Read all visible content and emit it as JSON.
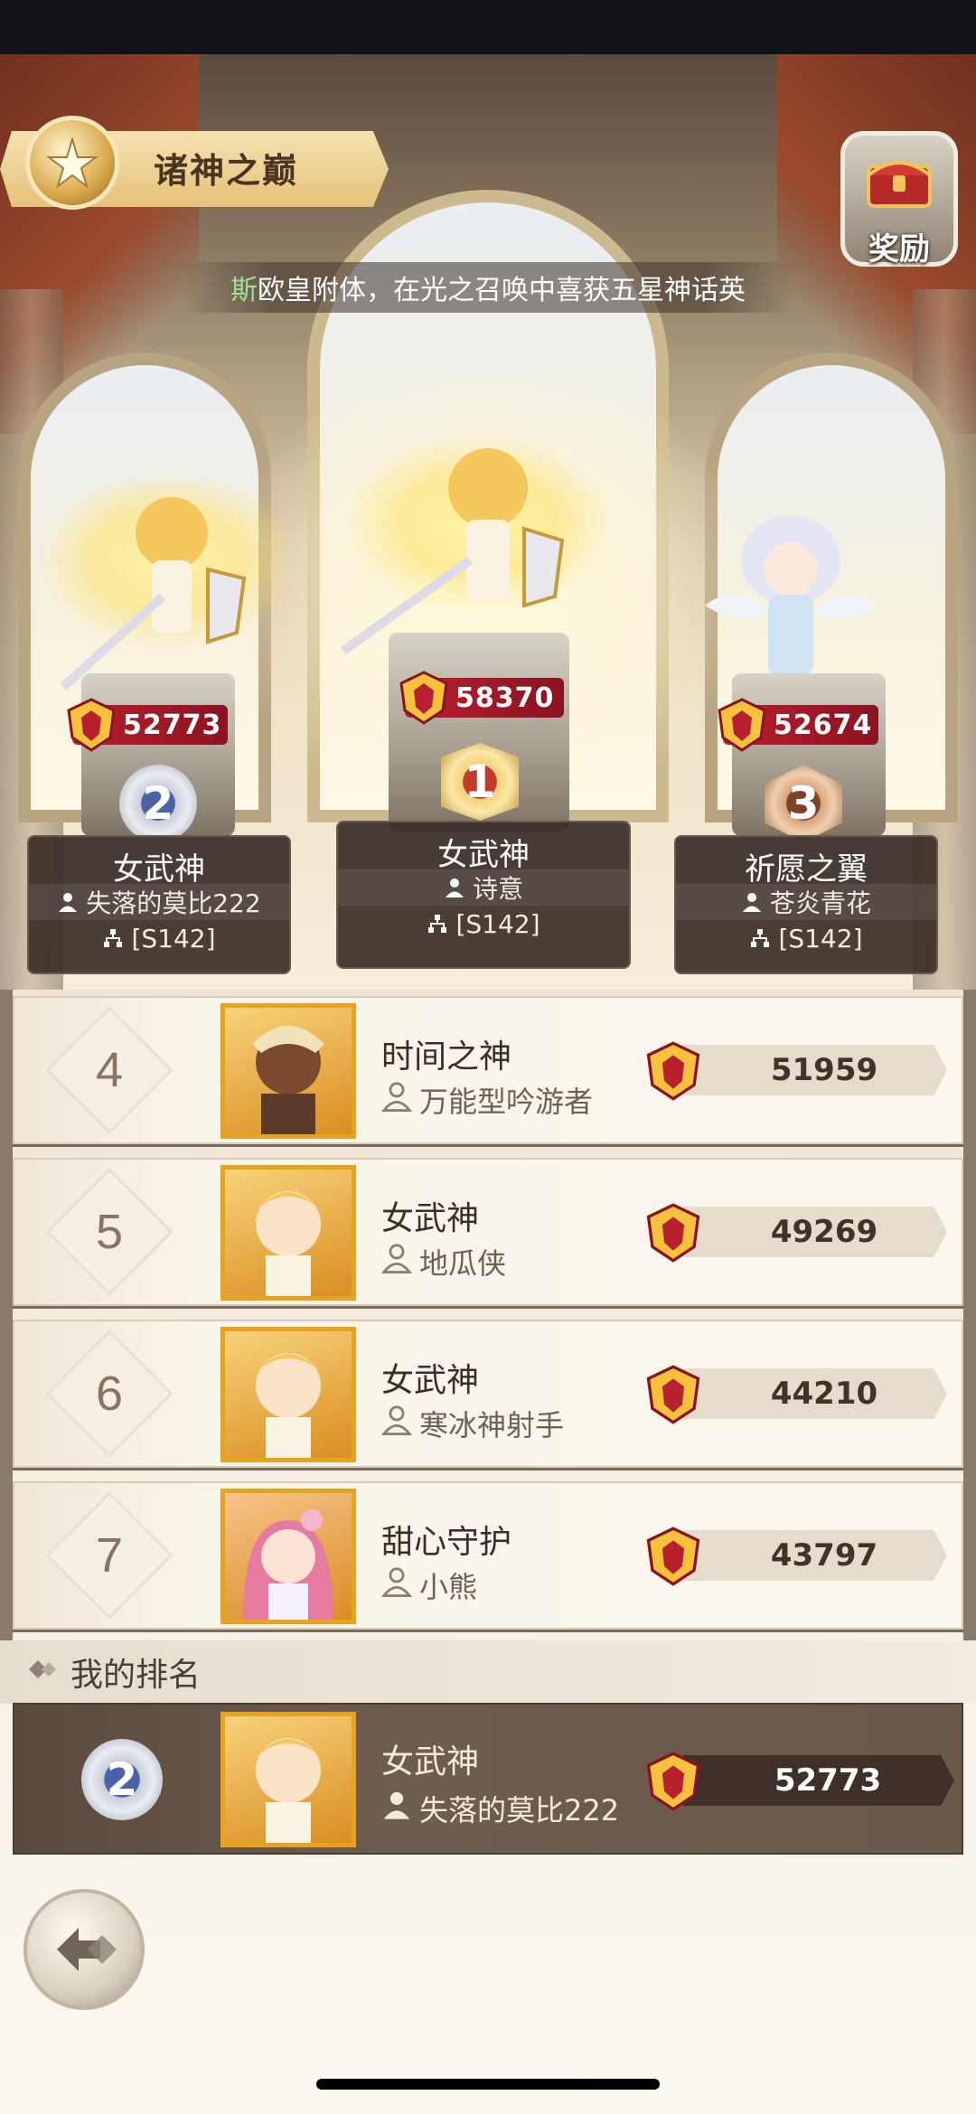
{
  "header": {
    "title": "诸神之巅",
    "reward_label": "奖励",
    "announcement_highlight": "斯",
    "announcement_text": "欧皇附体，在光之召唤中喜获五星神话英"
  },
  "podium": [
    {
      "rank": "2",
      "hero": "女武神",
      "player": "失落的莫比222",
      "server": "[S142]",
      "power": "52773"
    },
    {
      "rank": "1",
      "hero": "女武神",
      "player": "诗意",
      "server": "[S142]",
      "power": "58370"
    },
    {
      "rank": "3",
      "hero": "祈愿之翼",
      "player": "苍炎青花",
      "server": "[S142]",
      "power": "52674"
    }
  ],
  "ranking": [
    {
      "rank": "4",
      "hero": "时间之神",
      "player": "万能型吟游者",
      "power": "51959"
    },
    {
      "rank": "5",
      "hero": "女武神",
      "player": "地瓜侠",
      "power": "49269"
    },
    {
      "rank": "6",
      "hero": "女武神",
      "player": "寒冰神射手",
      "power": "44210"
    },
    {
      "rank": "7",
      "hero": "甜心守护",
      "player": "小熊",
      "power": "43797"
    }
  ],
  "my_rank": {
    "label": "我的排名",
    "rank": "2",
    "hero": "女武神",
    "player": "失落的莫比222",
    "power": "52773"
  },
  "colors": {
    "power_tag": "#b81f2f",
    "portrait_border": "#e7a21f",
    "dark_card": "#3a2e28"
  }
}
